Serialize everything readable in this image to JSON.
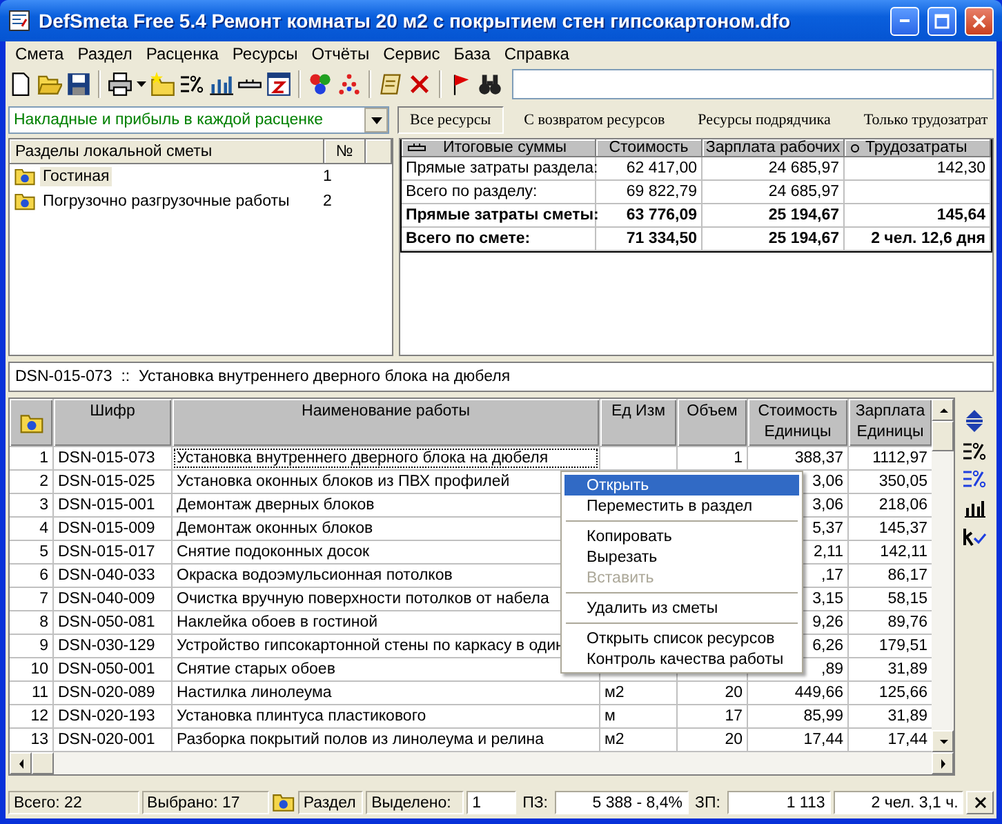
{
  "window": {
    "title": "DefSmeta Free 5.4   Ремонт комнаты 20 м2 с покрытием стен гипсокартоном.dfo"
  },
  "menu": [
    "Смета",
    "Раздел",
    "Расценка",
    "Ресурсы",
    "Отчёты",
    "Сервис",
    "База",
    "Справка"
  ],
  "overhead_dropdown": {
    "value": "Накладные и прибыль в каждой расценке"
  },
  "tabs": [
    {
      "label": "Все  ресурсы",
      "selected": true
    },
    {
      "label": "С возвратом ресурсов",
      "selected": false
    },
    {
      "label": "Ресурсы подрядчика",
      "selected": false
    },
    {
      "label": "Только трудозатрат",
      "selected": false
    }
  ],
  "sections": {
    "columns": [
      "Разделы локальной сметы",
      "№"
    ],
    "items": [
      {
        "name": "Гостиная",
        "number": "1",
        "selected": true
      },
      {
        "name": "Погрузочно разгрузочные работы",
        "number": "2",
        "selected": false
      }
    ]
  },
  "summary": {
    "columns": [
      "Итоговые суммы",
      "Стоимость",
      "Зарплата рабочих",
      "Трудозатраты"
    ],
    "rows": [
      {
        "kind": "section",
        "label": "Прямые затраты раздела:",
        "cost": "62 417,00",
        "salary": "24 685,97",
        "labor": "142,30"
      },
      {
        "kind": "section",
        "label": "Всего по разделу:",
        "cost": "69 822,79",
        "salary": "24 685,97",
        "labor": ""
      },
      {
        "kind": "total",
        "label": "Прямые затраты сметы:",
        "cost": "63 776,09",
        "salary": "25 194,67",
        "labor": "145,64"
      },
      {
        "kind": "total",
        "label": "Всего по смете:",
        "cost": "71 334,50",
        "salary": "25 194,67",
        "labor": "2 чел.  12,6 дня"
      }
    ]
  },
  "info_line": "DSN-015-073  ::  Установка внутреннего дверного блока на дюбеля",
  "grid": {
    "columns": [
      "Шифр",
      "Наименование работы",
      "Ед Изм",
      "Объем",
      "Стоимость Единицы",
      "Зарплата Единицы"
    ],
    "rows": [
      {
        "num": "1",
        "code": "DSN-015-073",
        "name": "Установка внутреннего дверного блока на дюбеля",
        "unit": "",
        "volume": "1",
        "cost": "388,37",
        "salary": "1112,97",
        "focused": true
      },
      {
        "num": "2",
        "code": "DSN-015-025",
        "name": "Установка оконных блоков из ПВХ профилей",
        "unit": "",
        "volume": "",
        "cost": "3,06",
        "salary": "350,05",
        "focused": false
      },
      {
        "num": "3",
        "code": "DSN-015-001",
        "name": "Демонтаж дверных блоков",
        "unit": "",
        "volume": "",
        "cost": "3,06",
        "salary": "218,06",
        "focused": false
      },
      {
        "num": "4",
        "code": "DSN-015-009",
        "name": "Демонтаж оконных блоков",
        "unit": "",
        "volume": "",
        "cost": "5,37",
        "salary": "145,37",
        "focused": false
      },
      {
        "num": "5",
        "code": "DSN-015-017",
        "name": "Снятие подоконных досок",
        "unit": "",
        "volume": "",
        "cost": "2,11",
        "salary": "142,11",
        "focused": false
      },
      {
        "num": "6",
        "code": "DSN-040-033",
        "name": "Окраска водоэмульсионная потолков",
        "unit": "",
        "volume": "",
        "cost": ",17",
        "salary": "86,17",
        "focused": false
      },
      {
        "num": "7",
        "code": "DSN-040-009",
        "name": "Очистка вручную поверхности потолков от набела",
        "unit": "",
        "volume": "",
        "cost": "3,15",
        "salary": "58,15",
        "focused": false
      },
      {
        "num": "8",
        "code": "DSN-050-081",
        "name": "Наклейка обоев  в  гостиной",
        "unit": "",
        "volume": "",
        "cost": "9,26",
        "salary": "89,76",
        "focused": false
      },
      {
        "num": "9",
        "code": "DSN-030-129",
        "name": "Устройство гипсокартонной стены по каркасу в один",
        "unit": "",
        "volume": "",
        "cost": "6,26",
        "salary": "179,51",
        "focused": false
      },
      {
        "num": "10",
        "code": "DSN-050-001",
        "name": "Снятие старых обоев",
        "unit": "",
        "volume": "",
        "cost": ",89",
        "salary": "31,89",
        "focused": false
      },
      {
        "num": "11",
        "code": "DSN-020-089",
        "name": "Настилка линолеума",
        "unit": "м2",
        "volume": "20",
        "cost": "449,66",
        "salary": "125,66",
        "focused": false
      },
      {
        "num": "12",
        "code": "DSN-020-193",
        "name": "Установка плинтуса пластикового",
        "unit": "м",
        "volume": "17",
        "cost": "85,99",
        "salary": "31,89",
        "focused": false
      },
      {
        "num": "13",
        "code": "DSN-020-001",
        "name": "Разборка покрытий полов из линолеума и релина",
        "unit": "м2",
        "volume": "20",
        "cost": "17,44",
        "salary": "17,44",
        "focused": false
      }
    ]
  },
  "context_menu": [
    {
      "kind": "item",
      "label": "Открыть",
      "selected": true,
      "disabled": false
    },
    {
      "kind": "item",
      "label": "Переместить в раздел",
      "selected": false,
      "disabled": false
    },
    {
      "kind": "separator"
    },
    {
      "kind": "item",
      "label": "Копировать",
      "selected": false,
      "disabled": false
    },
    {
      "kind": "item",
      "label": "Вырезать",
      "selected": false,
      "disabled": false
    },
    {
      "kind": "item",
      "label": "Вставить",
      "selected": false,
      "disabled": true
    },
    {
      "kind": "separator"
    },
    {
      "kind": "item",
      "label": "Удалить из сметы",
      "selected": false,
      "disabled": false
    },
    {
      "kind": "separator"
    },
    {
      "kind": "item",
      "label": "Открыть список ресурсов",
      "selected": false,
      "disabled": false
    },
    {
      "kind": "item",
      "label": "Контроль качества работы",
      "selected": false,
      "disabled": false
    }
  ],
  "status_bar": {
    "total": "Всего: 22",
    "chosen": "Выбрано: 17",
    "section": "Раздел",
    "highlighted_label": "Выделено:",
    "highlighted": "1",
    "pz_label": "ПЗ:",
    "pz": "5 388 - 8,4%",
    "zp_label": "ЗП:",
    "zp": "1 113",
    "labor": "2 чел.  3,1 ч."
  }
}
